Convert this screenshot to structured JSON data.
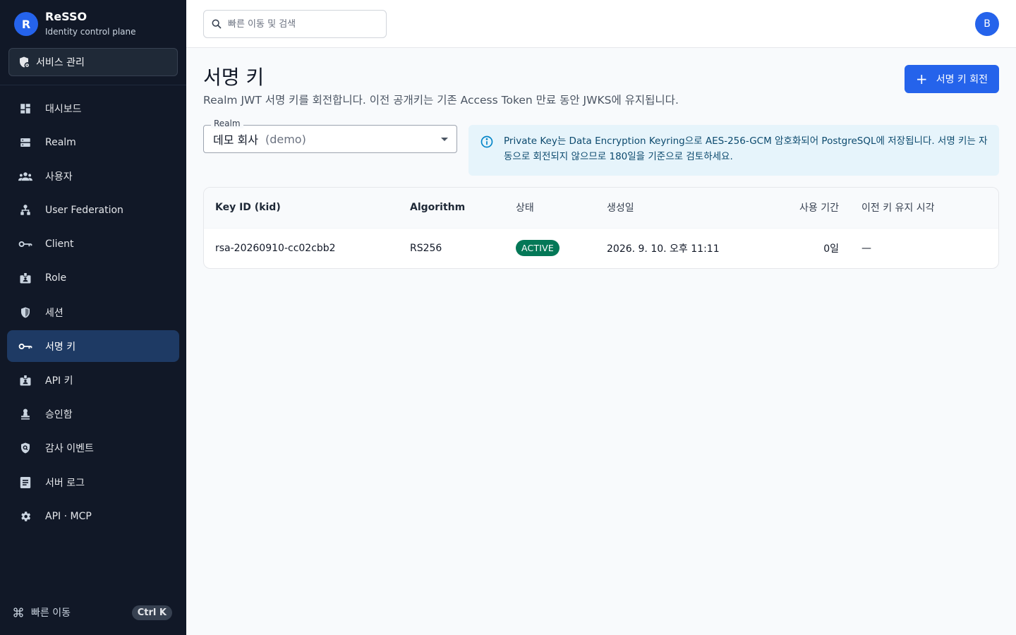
{
  "brand": {
    "logo_letter": "R",
    "name": "ReSSO",
    "subtitle": "Identity control plane"
  },
  "service_button": {
    "label": "서비스 관리",
    "icon": "shield-settings-icon"
  },
  "nav": {
    "items": [
      {
        "label": "대시보드",
        "icon": "dashboard-icon"
      },
      {
        "label": "Realm",
        "icon": "server-icon"
      },
      {
        "label": "사용자",
        "icon": "users-icon"
      },
      {
        "label": "User Federation",
        "icon": "hierarchy-icon"
      },
      {
        "label": "Client",
        "icon": "key-icon"
      },
      {
        "label": "Role",
        "icon": "badge-icon"
      },
      {
        "label": "세션",
        "icon": "shield-icon"
      },
      {
        "label": "서명 키",
        "icon": "key-icon",
        "active": true
      },
      {
        "label": "API 키",
        "icon": "badge-icon"
      },
      {
        "label": "승인함",
        "icon": "approval-stamp-icon"
      },
      {
        "label": "감사 이벤트",
        "icon": "shield-search-icon"
      },
      {
        "label": "서버 로그",
        "icon": "log-icon"
      },
      {
        "label": "API · MCP",
        "icon": "gear-icon"
      }
    ]
  },
  "footer": {
    "label": "빠른 이동",
    "shortcut": "Ctrl K",
    "icon": "command-icon"
  },
  "topbar": {
    "search_placeholder": "빠른 이동 및 검색",
    "avatar_letter": "B"
  },
  "page": {
    "title": "서명 키",
    "description": "Realm JWT 서명 키를 회전합니다. 이전 공개키는 기존 Access Token 만료 동안 JWKS에 유지됩니다.",
    "rotate_button": "서명 키 회전"
  },
  "realm_select": {
    "legend": "Realm",
    "value_name": "데모 회사",
    "value_code": "(demo)"
  },
  "info_message": "Private Key는 Data Encryption Keyring으로 AES-256-GCM 암호화되어 PostgreSQL에 저장됩니다. 서명 키는 자동으로 회전되지 않으므로 180일을 기준으로 검토하세요.",
  "table": {
    "headers": [
      "Key ID (kid)",
      "Algorithm",
      "상태",
      "생성일",
      "사용 기간",
      "이전 키 유지 시각"
    ],
    "rows": [
      {
        "kid": "rsa-20260910-cc02cbb2",
        "algorithm": "RS256",
        "status": "ACTIVE",
        "created": "2026. 9. 10. 오후 11:11",
        "age": "0일",
        "retain_until": "—"
      }
    ]
  },
  "colors": {
    "accent": "#2563eb",
    "sidebar_bg": "#111827",
    "active_nav": "#1e3a64",
    "status_active": "#047857",
    "info_bg": "#e6f4fb"
  }
}
